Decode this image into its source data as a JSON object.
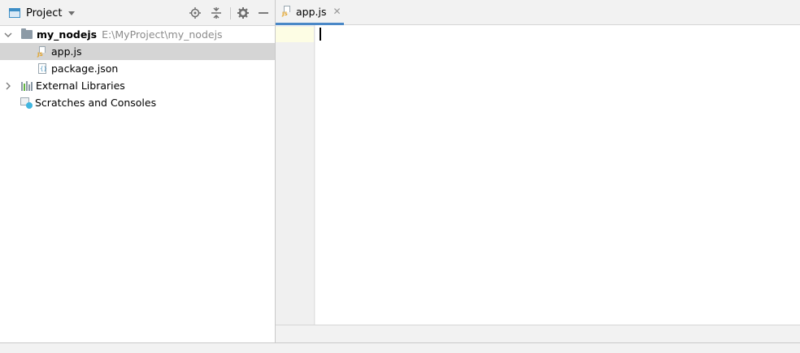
{
  "project_panel": {
    "title": "Project",
    "header_buttons": [
      "locate-icon",
      "collapse-all-icon",
      "gear-icon",
      "hide-icon"
    ],
    "tree": {
      "root": {
        "name": "my_nodejs",
        "path": "E:\\MyProject\\my_nodejs",
        "expanded": true
      },
      "files": [
        {
          "name": "app.js",
          "icon": "js-file-icon",
          "selected": true
        },
        {
          "name": "package.json",
          "icon": "json-file-icon",
          "selected": false
        }
      ],
      "external_libraries": "External Libraries",
      "scratches": "Scratches and Consoles"
    }
  },
  "editor": {
    "tab": {
      "label": "app.js",
      "icon": "js-file-icon",
      "active": true
    },
    "content": ""
  },
  "colors": {
    "accent": "#4a88c7",
    "selection": "#d5d5d5",
    "folder": "#8c9aa6",
    "js": "#e3a326",
    "scratch": "#40b6e0",
    "path_text": "#8c8c8c"
  }
}
